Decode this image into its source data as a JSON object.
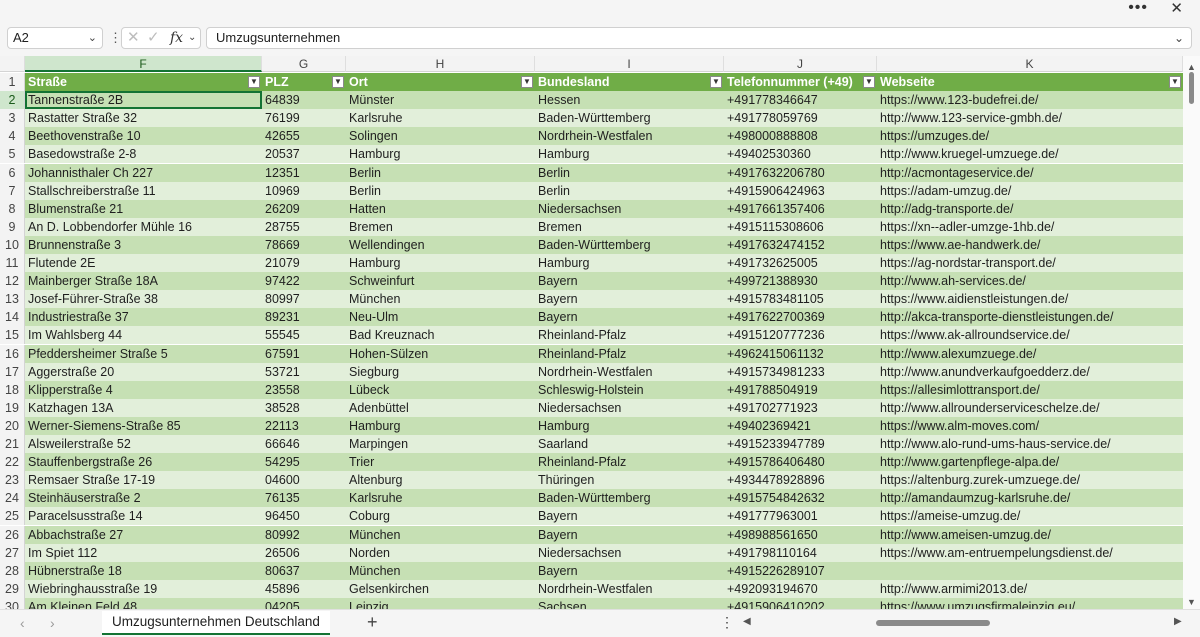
{
  "window": {
    "more_icon": "more-dots-icon",
    "close_label": "✕"
  },
  "formula_bar": {
    "name_box": "A2",
    "cancel_label": "✕",
    "enter_label": "✓",
    "fx_label": "fx",
    "content": "Umzugsunternehmen"
  },
  "columns": [
    {
      "letter": "F"
    },
    {
      "letter": "G"
    },
    {
      "letter": "H"
    },
    {
      "letter": "I"
    },
    {
      "letter": "J"
    },
    {
      "letter": "K"
    }
  ],
  "headers": [
    "Straße",
    "PLZ",
    "Ort",
    "Bundesland",
    "Telefonnummer (+49)",
    "Webseite"
  ],
  "rows": [
    {
      "n": "1",
      "cells": [
        "Straße",
        "PLZ",
        "Ort",
        "Bundesland",
        "Telefonnummer (+49)",
        "Webseite"
      ]
    },
    {
      "n": "2",
      "cells": [
        "Tannenstraße 2B",
        "64839",
        "Münster",
        "Hessen",
        "+491778346647",
        "https://www.123-budefrei.de/"
      ]
    },
    {
      "n": "3",
      "cells": [
        "Rastatter Straße 32",
        "76199",
        "Karlsruhe",
        "Baden-Württemberg",
        "+491778059769",
        "http://www.123-service-gmbh.de/"
      ]
    },
    {
      "n": "4",
      "cells": [
        "Beethovenstraße 10",
        "42655",
        "Solingen",
        "Nordrhein-Westfalen",
        "+498000888808",
        "https://umzuges.de/"
      ]
    },
    {
      "n": "5",
      "cells": [
        "Basedowstraße 2-8",
        "20537",
        "Hamburg",
        "Hamburg",
        "+49402530360",
        "http://www.kruegel-umzuege.de/"
      ]
    },
    {
      "n": "6",
      "cells": [
        "Johannisthaler Ch 227",
        "12351",
        "Berlin",
        "Berlin",
        "+4917632206780",
        "http://acmontageservice.de/"
      ]
    },
    {
      "n": "7",
      "cells": [
        "Stallschreiberstraße 11",
        "10969",
        "Berlin",
        "Berlin",
        "+4915906424963",
        "https://adam-umzug.de/"
      ]
    },
    {
      "n": "8",
      "cells": [
        "Blumenstraße 21",
        "26209",
        "Hatten",
        "Niedersachsen",
        "+4917661357406",
        "http://adg-transporte.de/"
      ]
    },
    {
      "n": "9",
      "cells": [
        "An D. Lobbendorfer Mühle 16",
        "28755",
        "Bremen",
        "Bremen",
        "+4915115308606",
        "https://xn--adler-umzge-1hb.de/"
      ]
    },
    {
      "n": "10",
      "cells": [
        "Brunnenstraße 3",
        "78669",
        "Wellendingen",
        "Baden-Württemberg",
        "+4917632474152",
        "https://www.ae-handwerk.de/"
      ]
    },
    {
      "n": "11",
      "cells": [
        "Flutende 2E",
        "21079",
        "Hamburg",
        "Hamburg",
        "+491732625005",
        "https://ag-nordstar-transport.de/"
      ]
    },
    {
      "n": "12",
      "cells": [
        "Mainberger Straße 18A",
        "97422",
        "Schweinfurt",
        "Bayern",
        "+499721388930",
        "http://www.ah-services.de/"
      ]
    },
    {
      "n": "13",
      "cells": [
        "Josef-Führer-Straße 38",
        "80997",
        "München",
        "Bayern",
        "+4915783481105",
        "https://www.aidienstleistungen.de/"
      ]
    },
    {
      "n": "14",
      "cells": [
        "Industriestraße 37",
        "89231",
        "Neu-Ulm",
        "Bayern",
        "+4917622700369",
        "http://akca-transporte-dienstleistungen.de/"
      ]
    },
    {
      "n": "15",
      "cells": [
        "Im Wahlsberg 44",
        "55545",
        "Bad Kreuznach",
        "Rheinland-Pfalz",
        "+4915120777236",
        "https://www.ak-allroundservice.de/"
      ]
    },
    {
      "n": "16",
      "cells": [
        "Pfeddersheimer Straße 5",
        "67591",
        "Hohen-Sülzen",
        "Rheinland-Pfalz",
        "+4962415061132",
        "http://www.alexumzuege.de/"
      ]
    },
    {
      "n": "17",
      "cells": [
        "Aggerstraße 20",
        "53721",
        "Siegburg",
        "Nordrhein-Westfalen",
        "+4915734981233",
        "http://www.anundverkaufgoedderz.de/"
      ]
    },
    {
      "n": "18",
      "cells": [
        "Klipperstraße 4",
        "23558",
        "Lübeck",
        "Schleswig-Holstein",
        "+491788504919",
        "https://allesimlottransport.de/"
      ]
    },
    {
      "n": "19",
      "cells": [
        "Katzhagen 13A",
        "38528",
        "Adenbüttel",
        "Niedersachsen",
        "+491702771923",
        "http://www.allrounderserviceschelze.de/"
      ]
    },
    {
      "n": "20",
      "cells": [
        "Werner-Siemens-Straße 85",
        "22113",
        "Hamburg",
        "Hamburg",
        "+49402369421",
        "https://www.alm-moves.com/"
      ]
    },
    {
      "n": "21",
      "cells": [
        "Alsweilerstraße 52",
        "66646",
        "Marpingen",
        "Saarland",
        "+4915233947789",
        "http://www.alo-rund-ums-haus-service.de/"
      ]
    },
    {
      "n": "22",
      "cells": [
        "Stauffenbergstraße 26",
        "54295",
        "Trier",
        "Rheinland-Pfalz",
        "+4915786406480",
        "http://www.gartenpflege-alpa.de/"
      ]
    },
    {
      "n": "23",
      "cells": [
        "Remsaer Straße 17-19",
        "04600",
        "Altenburg",
        "Thüringen",
        "+4934478928896",
        "https://altenburg.zurek-umzuege.de/"
      ]
    },
    {
      "n": "24",
      "cells": [
        "Steinhäuserstraße 2",
        "76135",
        "Karlsruhe",
        "Baden-Württemberg",
        "+4915754842632",
        "http://amandaumzug-karlsruhe.de/"
      ]
    },
    {
      "n": "25",
      "cells": [
        "Paracelsusstraße 14",
        "96450",
        "Coburg",
        "Bayern",
        "+491777963001",
        "https://ameise-umzug.de/"
      ]
    },
    {
      "n": "26",
      "cells": [
        "Abbachstraße 27",
        "80992",
        "München",
        "Bayern",
        "+498988561650",
        "http://www.ameisen-umzug.de/"
      ]
    },
    {
      "n": "27",
      "cells": [
        "Im Spiet 112",
        "26506",
        "Norden",
        "Niedersachsen",
        "+491798110164",
        "https://www.am-entruempelungsdienst.de/"
      ]
    },
    {
      "n": "28",
      "cells": [
        "Hübnerstraße 18",
        "80637",
        "München",
        "Bayern",
        "+4915226289107",
        ""
      ]
    },
    {
      "n": "29",
      "cells": [
        "Wiebringhausstraße 19",
        "45896",
        "Gelsenkirchen",
        "Nordrhein-Westfalen",
        "+492093194670",
        "http://www.armimi2013.de/"
      ]
    },
    {
      "n": "30",
      "cells": [
        "Am Kleinen Feld 48",
        "04205",
        "Leipzig",
        "Sachsen",
        "+4915906410202",
        "https://www.umzugsfirmaleipzig.eu/"
      ]
    }
  ],
  "sheet_tabs": [
    {
      "label": "Umzugsunternehmen Deutschland",
      "active": true
    }
  ],
  "bottom": {
    "add_label": "+",
    "prev_label": "‹",
    "next_label": "›",
    "more_label": "⋮"
  },
  "colors": {
    "header_fill": "#70ad47",
    "band_light": "#e2efda",
    "band_dark": "#c6e0b4",
    "selection": "#137333"
  }
}
